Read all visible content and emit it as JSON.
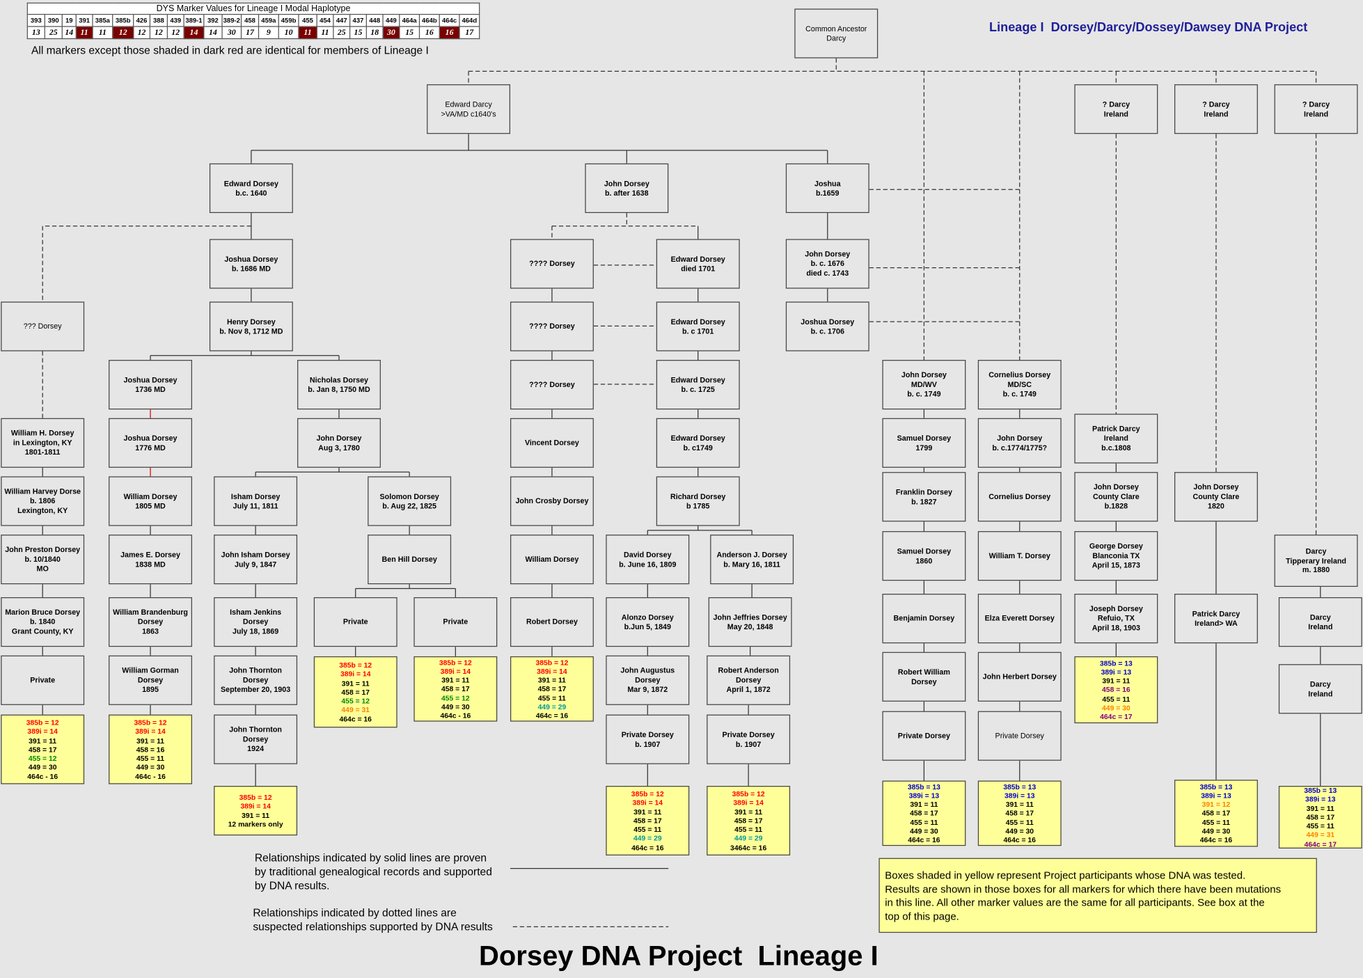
{
  "haplotype": {
    "caption": "DYS Marker Values for Lineage I Modal Haplotype",
    "markers": [
      "393",
      "390",
      "19",
      "391",
      "385a",
      "385b",
      "426",
      "388",
      "439",
      "389-1",
      "392",
      "389-2",
      "458",
      "459a",
      "459b",
      "455",
      "454",
      "447",
      "437",
      "448",
      "449",
      "464a",
      "464b",
      "464c",
      "464d"
    ],
    "values": [
      "13",
      "25",
      "14",
      "11",
      "11",
      "12",
      "12",
      "12",
      "12",
      "14",
      "14",
      "30",
      "17",
      "9",
      "10",
      "11",
      "11",
      "25",
      "15",
      "18",
      "30",
      "15",
      "16",
      "16",
      "17"
    ],
    "dark": [
      3,
      5,
      9,
      15,
      20,
      23
    ],
    "dark_color": "#7b0000",
    "note": "All markers except those shaded in dark red are identical for members of Lineage I"
  },
  "header_title": "Lineage I  Dorsey/Darcy/Dossey/Dawsey DNA Project",
  "footer_title": "Dorsey DNA Project  Lineage I",
  "legend": {
    "solid": "Relationships indicated by solid lines are proven\nby traditional genealogical records and supported\nby DNA results.",
    "dotted": "Relationships indicated by dotted lines are\nsuspected relationships supported by DNA results"
  },
  "yellow_note": "Boxes shaded in yellow represent Project participants whose DNA was tested.\nResults are shown in those boxes for all markers for which there have been mutations\nin this line.  All other marker values are the same for all participants.  See box at the\ntop of this page.",
  "colors": {
    "background": "#e6e6e6",
    "title_blue": "#1f1f99",
    "result_fill": "#ffff99",
    "red": "#ff0000",
    "green": "#008800",
    "orange": "#ff8000",
    "blue": "#0000cc",
    "purple": "#800080",
    "teal": "#009999"
  },
  "people": {
    "ancestor": "Common Ancestor\nDarcy",
    "edward_va": "Edward Darcy\n>VA/MD c1640's",
    "darcy_ire1": "? Darcy\nIreland",
    "darcy_ire2": "? Darcy\nIreland",
    "darcy_ire3": "? Darcy\nIreland",
    "edward_1640": "Edward Dorsey\nb.c. 1640",
    "john_1638": "John Dorsey\nb. after 1638",
    "joshua_1659": "Joshua\nb.1659",
    "joshua_1686": "Joshua Dorsey\nb. 1686 MD",
    "qqq_dorsey": "??? Dorsey",
    "henry_1712": "Henry Dorsey\nb. Nov 8, 1712 MD",
    "joshua_1736": "Joshua Dorsey\n1736 MD",
    "nicholas_1750": "Nicholas Dorsey\nb. Jan 8, 1750 MD",
    "william_h": "William H. Dorsey\nin Lexington, KY\n1801-1811",
    "joshua_1776": "Joshua Dorsey\n1776 MD",
    "john_1780": "John Dorsey\nAug 3, 1780",
    "william_harvey": "William Harvey Dorse\nb. 1806\nLexington, KY",
    "william_1805": "William Dorsey\n1805 MD",
    "isham_1811": "Isham Dorsey\nJuly 11, 1811",
    "solomon_1825": "Solomon Dorsey\nb.  Aug 22, 1825",
    "john_preston": "John Preston Dorsey\nb. 10/1840\nMO",
    "james_1838": "James E. Dorsey\n1838 MD",
    "john_isham": "John Isham Dorsey\nJuly 9, 1847",
    "ben_hill": "Ben Hill Dorsey",
    "marion_bruce": "Marion Bruce Dorsey\nb. 1840\nGrant County, KY",
    "william_brand": "William Brandenburg\nDorsey\n1863",
    "isham_jenkins": "Isham Jenkins\nDorsey\nJuly 18, 1869",
    "private_a": "Private",
    "private_b": "Private",
    "private_c": "Private",
    "william_gorman": "William Gorman\nDorsey\n1895",
    "john_thornton1": "John Thornton\nDorsey\nSeptember 20, 1903",
    "john_thornton2": "John Thornton\nDorsey\n1924",
    "q1": "???? Dorsey",
    "q2": "???? Dorsey",
    "q3": "???? Dorsey",
    "edward_1701d": "Edward Dorsey\ndied 1701",
    "edward_1701": "Edward Dorsey\nb. c 1701",
    "edward_1725": "Edward Dorsey\nb. c. 1725",
    "vincent": "Vincent Dorsey",
    "edward_1749": "Edward Dorsey\nb.  c1749",
    "john_crosby": "John Crosby Dorsey",
    "richard_1785": "Richard Dorsey\nb 1785",
    "william_d": "William Dorsey",
    "david_1809": "David Dorsey\nb. June 16, 1809",
    "anderson_1811": "Anderson J. Dorsey\nb. Mary 16, 1811",
    "robert_d": "Robert Dorsey",
    "alonzo": "Alonzo Dorsey\nb.Jun 5, 1849",
    "john_jeffries": "John Jeffries Dorsey\nMay 20, 1848",
    "john_augustus": "John Augustus\nDorsey\nMar 9, 1872",
    "robert_anderson": "Robert Anderson\nDorsey\nApril 1, 1872",
    "private_1907a": "Private Dorsey\nb. 1907",
    "private_1907b": "Private Dorsey\nb. 1907",
    "john_1676": "John Dorsey\nb. c. 1676\ndied c. 1743",
    "joshua_1706": "Joshua Dorsey\nb. c. 1706",
    "john_1749": "John Dorsey\nMD/WV\nb. c. 1749",
    "cornelius_1749": "Cornelius Dorsey\nMD/SC\nb. c. 1749",
    "samuel_1799": "Samuel Dorsey\n1799",
    "john_1774": "John Dorsey\nb. c.1774/1775?",
    "franklin": "Franklin Dorsey\nb. 1827",
    "cornelius_d": "Cornelius Dorsey",
    "samuel_1860": "Samuel Dorsey\n1860",
    "william_t": "William T. Dorsey",
    "benjamin": "Benjamin Dorsey",
    "elza": "Elza Everett Dorsey",
    "robert_william": "Robert William\nDorsey",
    "john_herbert": "John Herbert Dorsey",
    "private_rw": "Private Dorsey",
    "private_jh": "Private Dorsey",
    "patrick_1808": "Patrick Darcy\nIreland\nb.c.1808",
    "john_clare1828": "John Dorsey\nCounty Clare\nb.1828",
    "george": "George Dorsey\nBlanconia TX\nApril 15, 1873",
    "joseph": "Joseph Dorsey\nRefuio, TX\nApril 18, 1903",
    "john_clare1820": "John Dorsey\nCounty Clare\n1820",
    "patrick_wa": "Patrick Darcy\nIreland> WA",
    "darcy_tipp": "Darcy\nTipperary Ireland\nm. 1880",
    "darcy_ire4": "Darcy\nIreland",
    "darcy_ire5": "Darcy\nIreland"
  },
  "results": {
    "r1": [
      [
        "385b = 12",
        "red"
      ],
      [
        "389i = 14",
        "red"
      ],
      [
        "391 = 11",
        "black"
      ],
      [
        "458 = 17",
        "black"
      ],
      [
        "455 = 12",
        "green"
      ],
      [
        "449 = 30",
        "black"
      ],
      [
        "464c - 16",
        "black"
      ]
    ],
    "r2": [
      [
        "385b = 12",
        "red"
      ],
      [
        "389i = 14",
        "red"
      ],
      [
        "391 = 11",
        "black"
      ],
      [
        "458 = 16",
        "black"
      ],
      [
        "455 = 11",
        "black"
      ],
      [
        "449 = 30",
        "black"
      ],
      [
        "464c - 16",
        "black"
      ]
    ],
    "r3": [
      [
        "385b = 12",
        "red"
      ],
      [
        "389i = 14",
        "red"
      ],
      [
        "391 = 11",
        "black"
      ],
      [
        "12 markers only",
        "black"
      ]
    ],
    "r4": [
      [
        "385b = 12",
        "red"
      ],
      [
        "389i = 14",
        "red"
      ],
      [
        "391 = 11",
        "black"
      ],
      [
        "458 = 17",
        "black"
      ],
      [
        "455 = 12",
        "green"
      ],
      [
        "449 = 31",
        "orange"
      ],
      [
        "464c = 16",
        "black"
      ]
    ],
    "r5": [
      [
        "385b = 12",
        "red"
      ],
      [
        "389i = 14",
        "red"
      ],
      [
        "391 = 11",
        "black"
      ],
      [
        "458 = 17",
        "black"
      ],
      [
        "455 = 12",
        "green"
      ],
      [
        "449 = 30",
        "black"
      ],
      [
        "464c - 16",
        "black"
      ]
    ],
    "r6": [
      [
        "385b = 12",
        "red"
      ],
      [
        "389i = 14",
        "red"
      ],
      [
        "391 = 11",
        "black"
      ],
      [
        "458 = 17",
        "black"
      ],
      [
        "455 = 11",
        "black"
      ],
      [
        "449 = 29",
        "teal"
      ],
      [
        "464c = 16",
        "black"
      ]
    ],
    "r7": [
      [
        "385b = 12",
        "red"
      ],
      [
        "389i = 14",
        "red"
      ],
      [
        "391 = 11",
        "black"
      ],
      [
        "458 = 17",
        "black"
      ],
      [
        "455 = 11",
        "black"
      ],
      [
        "449 = 29",
        "teal"
      ],
      [
        "464c = 16",
        "black"
      ]
    ],
    "r8": [
      [
        "385b = 12",
        "red"
      ],
      [
        "389i = 14",
        "red"
      ],
      [
        "391 = 11",
        "black"
      ],
      [
        "458 = 17",
        "black"
      ],
      [
        "455 = 11",
        "black"
      ],
      [
        "449 = 29",
        "teal"
      ],
      [
        "3464c = 16",
        "black"
      ]
    ],
    "r9": [
      [
        "385b = 13",
        "blue"
      ],
      [
        "389i = 13",
        "blue"
      ],
      [
        "391 = 11",
        "black"
      ],
      [
        "458 = 17",
        "black"
      ],
      [
        "455 = 11",
        "black"
      ],
      [
        "449 = 30",
        "black"
      ],
      [
        "464c = 16",
        "black"
      ]
    ],
    "r10": [
      [
        "385b = 13",
        "blue"
      ],
      [
        "389i = 13",
        "blue"
      ],
      [
        "391 = 11",
        "black"
      ],
      [
        "458 = 17",
        "black"
      ],
      [
        "455 = 11",
        "black"
      ],
      [
        "449 = 30",
        "black"
      ],
      [
        "464c = 16",
        "black"
      ]
    ],
    "r11": [
      [
        "385b = 13",
        "blue"
      ],
      [
        "389i = 13",
        "blue"
      ],
      [
        "391 = 11",
        "black"
      ],
      [
        "458 = 16",
        "purple"
      ],
      [
        "455 = 11",
        "black"
      ],
      [
        "449 = 30",
        "orange"
      ],
      [
        "464c = 17",
        "purple"
      ]
    ],
    "r12": [
      [
        "385b = 13",
        "blue"
      ],
      [
        "389i = 13",
        "blue"
      ],
      [
        "391 = 12",
        "orange"
      ],
      [
        "458 = 17",
        "black"
      ],
      [
        "455 = 11",
        "black"
      ],
      [
        "449 = 30",
        "black"
      ],
      [
        "464c = 16",
        "black"
      ]
    ],
    "r13": [
      [
        "385b = 13",
        "blue"
      ],
      [
        "389i = 13",
        "blue"
      ],
      [
        "391 = 11",
        "black"
      ],
      [
        "458 = 17",
        "black"
      ],
      [
        "455 = 11",
        "black"
      ],
      [
        "449 = 31",
        "orange"
      ],
      [
        "464c = 17",
        "purple"
      ]
    ]
  }
}
